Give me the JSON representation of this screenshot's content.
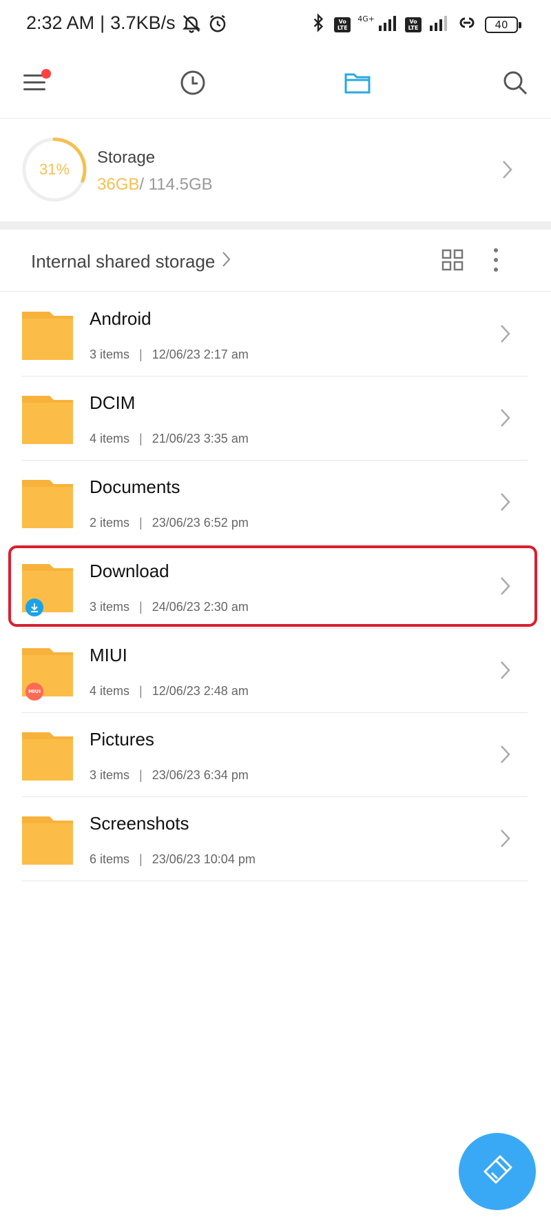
{
  "status_bar": {
    "time": "2:32 AM",
    "net_speed": "3.7KB/s",
    "separator": "|",
    "network_label": "4G+",
    "volte_label_top": "Vo",
    "volte_label_bottom": "LTE",
    "battery": "40"
  },
  "toolbar": {
    "icons": [
      "menu-icon",
      "clock-icon",
      "folder-icon",
      "search-icon"
    ],
    "active_color": "#2aa8e0"
  },
  "storage": {
    "percent": "31%",
    "fill_fraction": 0.31,
    "title": "Storage",
    "used": "36GB",
    "total": "/ 114.5GB",
    "accent": "#f5c04f"
  },
  "path": {
    "label": "Internal shared storage"
  },
  "folders": [
    {
      "name": "Android",
      "count": "3 items",
      "date": "12/06/23 2:17 am"
    },
    {
      "name": "DCIM",
      "count": "4 items",
      "date": "21/06/23 3:35 am"
    },
    {
      "name": "Documents",
      "count": "2 items",
      "date": "23/06/23 6:52 pm"
    },
    {
      "name": "Download",
      "count": "3 items",
      "date": "24/06/23 2:30 am"
    },
    {
      "name": "MIUI",
      "count": "4 items",
      "date": "12/06/23 2:48 am",
      "badge_text": "MIUI"
    },
    {
      "name": "Pictures",
      "count": "3 items",
      "date": "23/06/23 6:34 pm"
    },
    {
      "name": "Screenshots",
      "count": "6 items",
      "date": "23/06/23 10:04 pm"
    }
  ],
  "meta_separator": "|",
  "fab": {
    "icon": "clean-brush-icon",
    "color": "#3aa9f5"
  },
  "highlight_color": "#d9202e"
}
